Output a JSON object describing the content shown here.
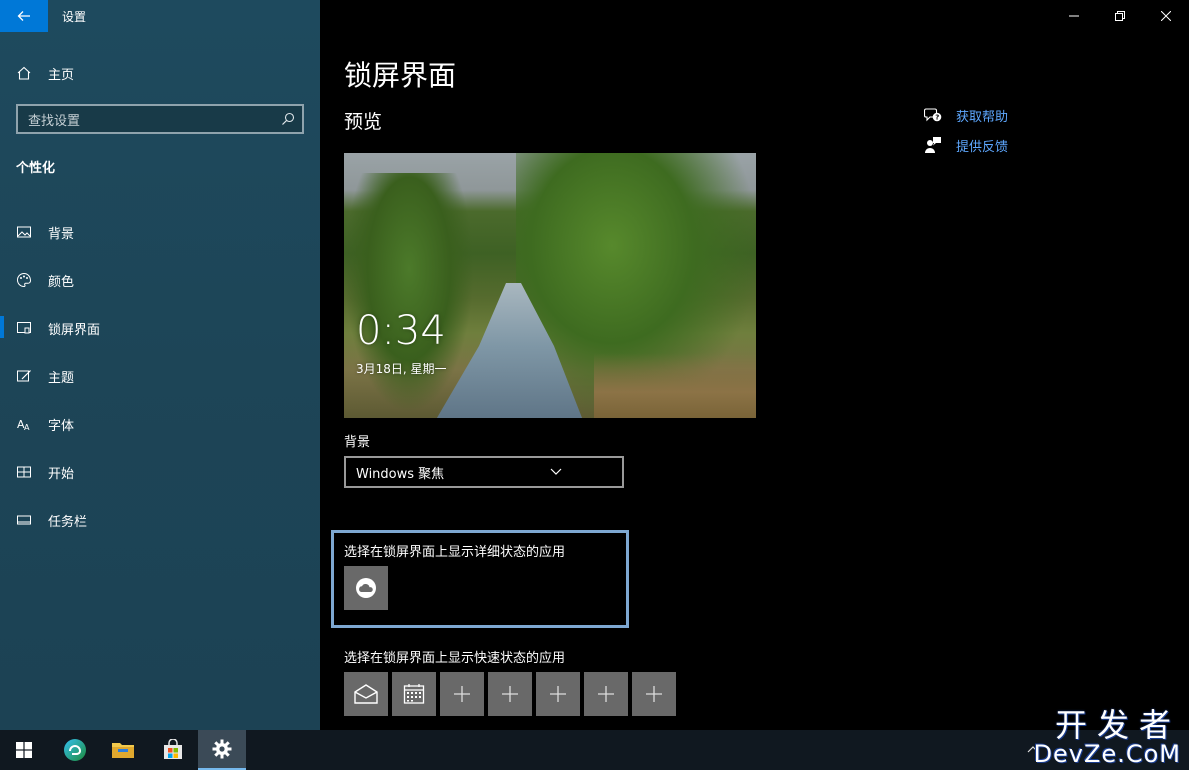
{
  "window": {
    "app_title": "设置",
    "page_title": "锁屏界面"
  },
  "sidebar": {
    "home_label": "主页",
    "search_placeholder": "查找设置",
    "section_title": "个性化",
    "items": [
      {
        "label": "背景",
        "icon": "picture-icon"
      },
      {
        "label": "颜色",
        "icon": "palette-icon"
      },
      {
        "label": "锁屏界面",
        "icon": "lock-screen-icon",
        "selected": true
      },
      {
        "label": "主题",
        "icon": "theme-icon"
      },
      {
        "label": "字体",
        "icon": "font-icon"
      },
      {
        "label": "开始",
        "icon": "start-icon"
      },
      {
        "label": "任务栏",
        "icon": "taskbar-icon"
      }
    ]
  },
  "main": {
    "preview_title": "预览",
    "preview": {
      "time": "0:34",
      "date": "3月18日, 星期一"
    },
    "background_label": "背景",
    "background_value": "Windows 聚焦",
    "detail_label": "选择在锁屏界面上显示详细状态的应用",
    "quick_label": "选择在锁屏界面上显示快速状态的应用",
    "quick_tiles": [
      "mail-icon",
      "calendar-icon",
      "plus-icon",
      "plus-icon",
      "plus-icon",
      "plus-icon",
      "plus-icon"
    ]
  },
  "help": {
    "get_help": "获取帮助",
    "feedback": "提供反馈"
  },
  "watermark": {
    "line1": "开发者",
    "line2": "DevZe.CoM"
  },
  "colors": {
    "accent": "#0078d7",
    "link": "#5ea8ff",
    "sidebar": "#1e4a5e",
    "focus_border": "#7ea8d2"
  }
}
